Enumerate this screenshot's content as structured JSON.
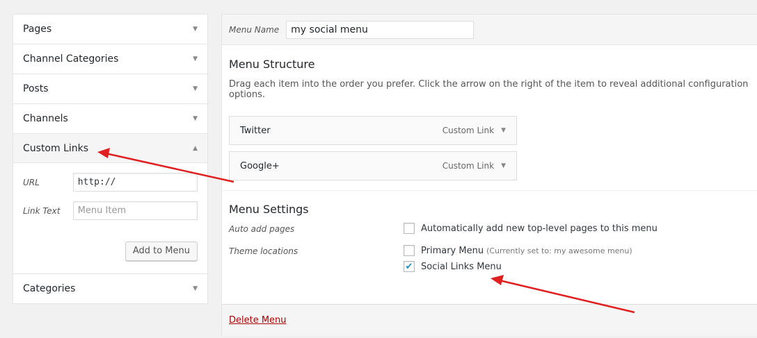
{
  "accordion": {
    "items": [
      {
        "label": "Pages"
      },
      {
        "label": "Channel Categories"
      },
      {
        "label": "Posts"
      },
      {
        "label": "Channels"
      },
      {
        "label": "Custom Links"
      },
      {
        "label": "Categories"
      }
    ],
    "custom_links": {
      "url_label": "URL",
      "url_value": "http://",
      "link_text_label": "Link Text",
      "link_text_placeholder": "Menu Item",
      "add_button": "Add to Menu"
    }
  },
  "menu": {
    "name_label": "Menu Name",
    "name_value": "my social menu",
    "structure_title": "Menu Structure",
    "structure_desc": "Drag each item into the order you prefer. Click the arrow on the right of the item to reveal additional configuration options.",
    "items": [
      {
        "title": "Twitter",
        "type": "Custom Link"
      },
      {
        "title": "Google+",
        "type": "Custom Link"
      }
    ],
    "settings_title": "Menu Settings",
    "auto_add_label": "Auto add pages",
    "auto_add_option": "Automatically add new top-level pages to this menu",
    "theme_locations_label": "Theme locations",
    "primary_menu": "Primary Menu",
    "primary_note": "(Currently set to: my awesome menu)",
    "social_menu": "Social Links Menu",
    "social_checked": true,
    "delete_label": "Delete Menu"
  },
  "colors": {
    "annotation_arrow": "#e02020",
    "check": "#1e8cbe",
    "delete": "#aa0000"
  }
}
